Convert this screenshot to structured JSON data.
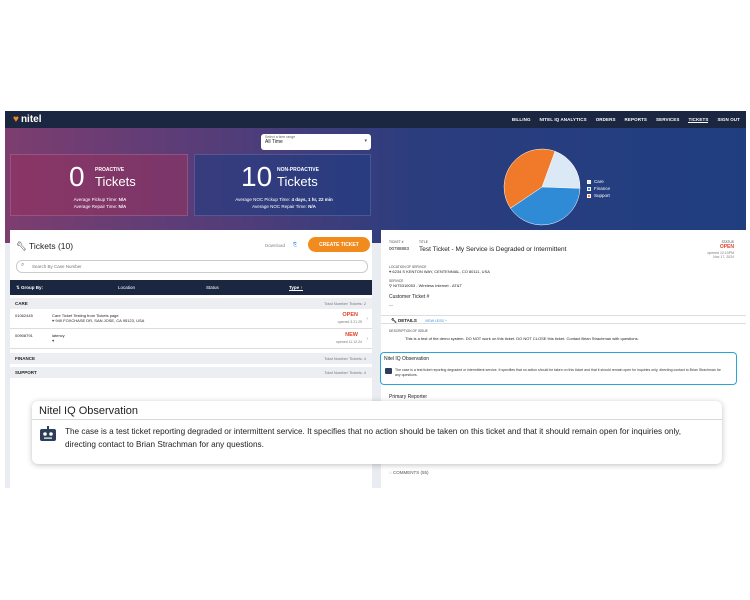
{
  "nav": {
    "brand": "nitel",
    "links": [
      "BILLING",
      "NITEL IQ ANALYTICS",
      "ORDERS",
      "REPORTS",
      "SERVICES",
      "TICKETS",
      "SIGN OUT"
    ],
    "active": "TICKETS"
  },
  "time_range": {
    "label": "Select a time range",
    "value": "All Time"
  },
  "proactive": {
    "count": "0",
    "top": "PROACTIVE",
    "label": "Tickets",
    "pickup_label": "Average Pickup Time:",
    "pickup_value": "N/A",
    "repair_label": "Average Repair Time:",
    "repair_value": "N/A"
  },
  "non_proactive": {
    "count": "10",
    "top": "NON-PROACTIVE",
    "label": "Tickets",
    "pickup_label": "Average NOC Pickup Time:",
    "pickup_value": "4 days, 1 hr, 22 min",
    "repair_label": "Average NOC Repair Time:",
    "repair_value": "N/A"
  },
  "chart_data": {
    "type": "pie",
    "categories": [
      "Care",
      "Finance",
      "Support"
    ],
    "values": [
      2,
      4,
      4
    ],
    "colors": [
      "#dbe8f6",
      "#2f8bd6",
      "#f07a2a"
    ]
  },
  "tickets_panel": {
    "title": "Tickets (10)",
    "download": "Download",
    "create": "CREATE TICKET",
    "search_placeholder": "Search By Case Number",
    "group_by": "Group By:",
    "col_location": "Location",
    "col_status": "Status",
    "col_type": "Type"
  },
  "groups": {
    "care": {
      "name": "CARE",
      "total": "Total Number Tickets: 2"
    },
    "finance": {
      "name": "FINANCE",
      "total": "Total Number Tickets: 4"
    },
    "support": {
      "name": "SUPPORT",
      "total": "Total Number Tickets: 4"
    }
  },
  "tickets": [
    {
      "num": "01062445",
      "desc": "Care Ticket Testing from Tickets page",
      "addr": "940 FOXCHASE DR, SAN JOSE, CA 95123, USA",
      "status": "OPEN",
      "opened": "opened 3.21.25"
    },
    {
      "num": "00908791",
      "desc": "latency",
      "addr": "",
      "status": "NEW",
      "opened": "opened 11.12.24"
    }
  ],
  "detail": {
    "ticket_label": "TICKET #",
    "ticket_num": "00788883",
    "title_label": "TITLE",
    "title": "Test Ticket - My Service is Degraded or Intermittent",
    "status_label": "STATUS",
    "status": "OPEN",
    "opened": "opened 12:10PM",
    "opened_date": "Nov 17, 2024",
    "location_label": "LOCATION OF SERVICE",
    "location": "6234 S KENTON WAY, CENTENNIAL, CO 80111, USA",
    "service_label": "SERVICE",
    "service": "NIT5310053 - Wireless Internet - AT&T",
    "customer_ticket_label": "Customer Ticket #",
    "customer_ticket": "---",
    "details_label": "DETAILS",
    "view_less": "VIEW LESS",
    "desc_label": "DESCRIPTION OF ISSUE",
    "desc": "This is a test of the demo system. DO NOT work on this ticket. DO NOT CLOSE this ticket. Contact Brian Strachman with questions.",
    "primary_reporter": "Primary Reporter",
    "comments": "COMMENTS (55)"
  },
  "observation": {
    "title": "Nitel IQ Observation",
    "text": "The case is a test ticket reporting degraded or intermittent service. It specifies that no action should be taken on this ticket and that it should remain open for inquiries only, directing contact to Brian Strachman for any questions."
  }
}
